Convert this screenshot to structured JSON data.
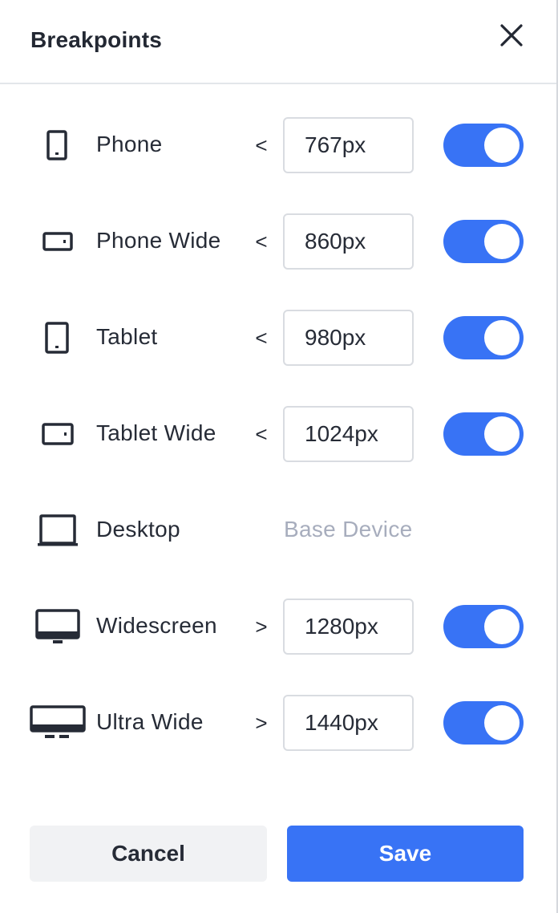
{
  "header": {
    "title": "Breakpoints",
    "close_icon": "close-icon"
  },
  "breakpoints": [
    {
      "label": "Phone",
      "icon": "phone-portrait-icon",
      "operator": "<",
      "value": "767px",
      "enabled": true
    },
    {
      "label": "Phone Wide",
      "icon": "phone-landscape-icon",
      "operator": "<",
      "value": "860px",
      "enabled": true
    },
    {
      "label": "Tablet",
      "icon": "tablet-portrait-icon",
      "operator": "<",
      "value": "980px",
      "enabled": true
    },
    {
      "label": "Tablet Wide",
      "icon": "tablet-landscape-icon",
      "operator": "<",
      "value": "1024px",
      "enabled": true
    },
    {
      "label": "Desktop",
      "icon": "laptop-icon",
      "base_text": "Base Device"
    },
    {
      "label": "Widescreen",
      "icon": "monitor-icon",
      "operator": ">",
      "value": "1280px",
      "enabled": true
    },
    {
      "label": "Ultra Wide",
      "icon": "ultrawide-monitor-icon",
      "operator": ">",
      "value": "1440px",
      "enabled": true
    }
  ],
  "footer": {
    "cancel_label": "Cancel",
    "save_label": "Save"
  },
  "colors": {
    "accent": "#3873f5",
    "muted_text": "#a7adbd",
    "text": "#262b36"
  }
}
